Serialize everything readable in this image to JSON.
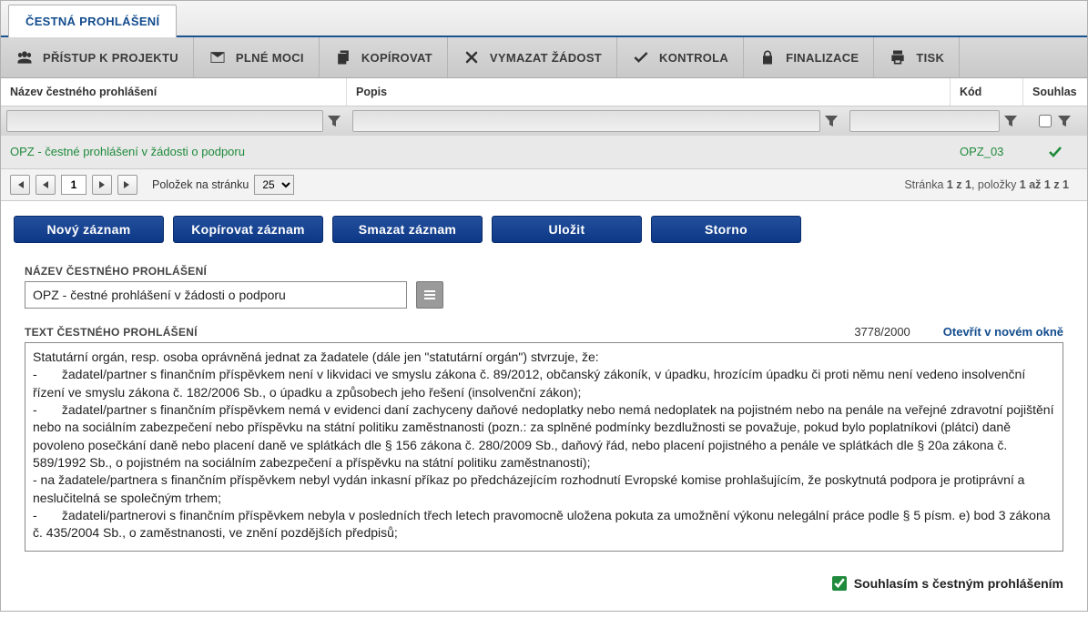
{
  "tab_title": "ČESTNÁ PROHLÁŠENÍ",
  "toolbar": {
    "pristup": "PŘÍSTUP K PROJEKTU",
    "plnemoci": "PLNÉ MOCI",
    "kopirovat": "KOPÍROVAT",
    "vymazat": "VYMAZAT ŽÁDOST",
    "kontrola": "KONTROLA",
    "finalizace": "FINALIZACE",
    "tisk": "TISK"
  },
  "columns": {
    "nazev": "Název čestného prohlášení",
    "popis": "Popis",
    "kod": "Kód",
    "souhlas": "Souhlas"
  },
  "row": {
    "nazev": "OPZ - čestné prohlášení v žádosti o podporu",
    "popis": "",
    "kod": "OPZ_03"
  },
  "paging": {
    "page": "1",
    "perpage_label": "Položek na stránku",
    "perpage_value": "25",
    "info_prefix": "Stránka ",
    "info_mid1": "1 z 1",
    "info_sep": ", položky ",
    "info_mid2": "1 až 1 z 1"
  },
  "actions": {
    "novy": "Nový záznam",
    "kopirovat": "Kopírovat záznam",
    "smazat": "Smazat záznam",
    "ulozit": "Uložit",
    "storno": "Storno"
  },
  "form": {
    "nazev_label": "NÁZEV ČESTNÉHO PROHLÁŠENÍ",
    "nazev_value": "OPZ - čestné prohlášení v žádosti o podporu",
    "text_label": "TEXT ČESTNÉHO PROHLÁŠENÍ",
    "counter": "3778/2000",
    "open_new": "Otevřít v novém okně",
    "text_value": "Statutární orgán, resp. osoba oprávněná jednat za žadatele (dále jen \"statutární orgán\") stvrzuje, že:\n-       žadatel/partner s finančním příspěvkem není v likvidaci ve smyslu zákona č. 89/2012, občanský zákoník, v úpadku, hrozícím úpadku či proti němu není vedeno insolvenční řízení ve smyslu zákona č. 182/2006 Sb., o úpadku a způsobech jeho řešení (insolvenční zákon);\n-       žadatel/partner s finančním příspěvkem nemá v evidenci daní zachyceny daňové nedoplatky nebo nemá nedoplatek na pojistném nebo na penále na veřejné zdravotní pojištění nebo na sociálním zabezpečení nebo příspěvku na státní politiku zaměstnanosti (pozn.: za splněné podmínky bezdlužnosti se považuje, pokud bylo poplatníkovi (plátci) daně povoleno posečkání daně nebo placení daně ve splátkách dle § 156 zákona č. 280/2009 Sb., daňový řád, nebo placení pojistného a penále ve splátkách dle § 20a zákona č. 589/1992 Sb., o pojistném na sociálním zabezpečení a příspěvku na státní politiku zaměstnanosti);\n- na žadatele/partnera s finančním příspěvkem nebyl vydán inkasní příkaz po předcházejícím rozhodnutí Evropské komise prohlašujícím, že poskytnutá podpora je protiprávní a neslučitelná se společným trhem;\n-       žadateli/partnerovi s finančním příspěvkem nebyla v posledních třech letech pravomocně uložena pokuta za umožnění výkonu nelegální práce podle § 5 písm. e) bod 3 zákona č. 435/2004 Sb., o zaměstnanosti, ve znění pozdějších předpisů;",
    "consent_label": "Souhlasím s čestným prohlášením",
    "consent_checked": true
  }
}
